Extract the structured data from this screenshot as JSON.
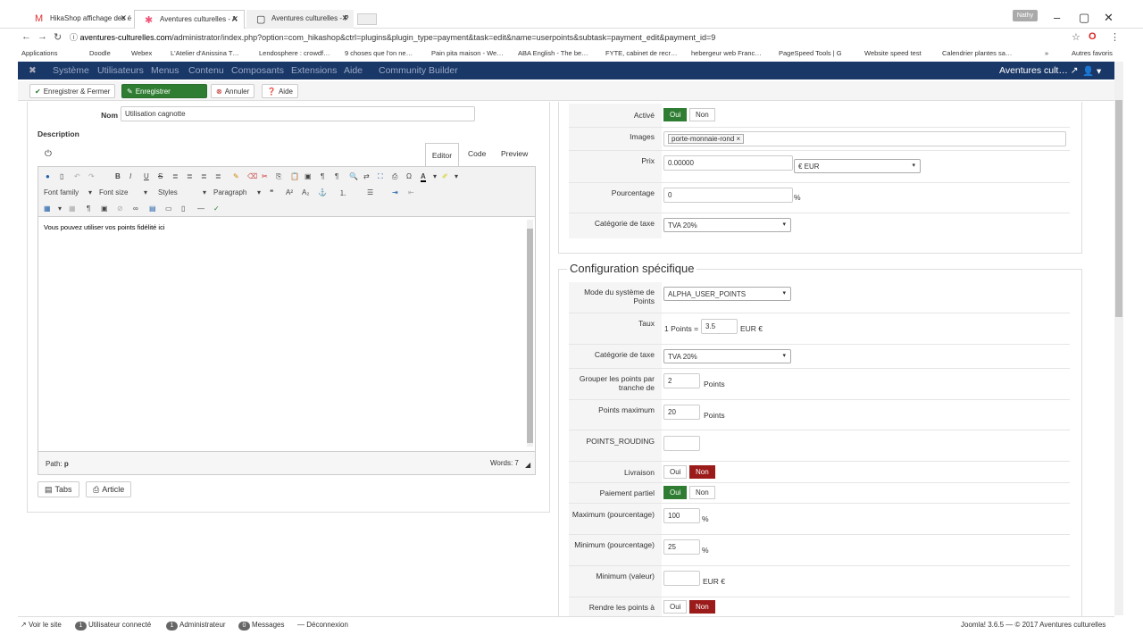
{
  "browser": {
    "tabs": [
      {
        "label": "HikaShop affichage des é",
        "icon": "gmail-icon"
      },
      {
        "label": "Aventures culturelles - A",
        "icon": "joomla-icon"
      },
      {
        "label": "Aventures culturelles - P",
        "icon": "page-icon"
      }
    ],
    "user_badge": "Nathy",
    "url_host": "aventures-culturelles.com",
    "url_path": "/administrator/index.php?option=com_hikashop&ctrl=plugins&plugin_type=payment&task=edit&name=userpoints&subtask=payment_edit&payment_id=9",
    "bookmarks": [
      "Applications",
      "Doodle",
      "Webex",
      "L'Atelier d'Anissina T…",
      "Lendosphere : crowdf…",
      "9 choses que l'on ne…",
      "Pain pita maison - We…",
      "ABA English - The be…",
      "FYTE, cabinet de recr…",
      "hebergeur web Franc…",
      "PageSpeed Tools | G",
      "Website speed test",
      "Calendrier plantes sa…",
      "»",
      "Autres favoris"
    ]
  },
  "joomla_nav": {
    "items": [
      "Système",
      "Utilisateurs",
      "Menus",
      "Contenu",
      "Composants",
      "Extensions",
      "Aide",
      "Community Builder"
    ],
    "site_name": "Aventures cult…"
  },
  "toolbar": {
    "save_close": "Enregistrer & Fermer",
    "save": "Enregistrer",
    "cancel": "Annuler",
    "help": "Aide"
  },
  "left": {
    "nom_label": "Nom",
    "nom_value": "Utilisation cagnotte",
    "description_label": "Description",
    "editor_tabs": [
      "Editor",
      "Code",
      "Preview"
    ],
    "font_family": "Font family",
    "font_size": "Font size",
    "styles": "Styles",
    "paragraph": "Paragraph",
    "content": "Vous pouvez utiliser vos points fidélité ici",
    "path_label": "Path:",
    "path_value": "p",
    "words": "Words: 7",
    "btn_tabs": "Tabs",
    "btn_article": "Article"
  },
  "right_general": {
    "active_label": "Activé",
    "oui": "Oui",
    "non": "Non",
    "images_label": "Images",
    "image_tag": "porte-monnaie-rond",
    "prix_label": "Prix",
    "prix_value": "0.00000",
    "currency": "€ EUR",
    "pourcentage_label": "Pourcentage",
    "pourcentage_value": "0",
    "percent": "%",
    "tax_label": "Catégorie de taxe",
    "tax_value": "TVA 20%"
  },
  "specific": {
    "legend": "Configuration spécifique",
    "mode_label": "Mode du système de Points",
    "mode_value": "ALPHA_USER_POINTS",
    "taux_label": "Taux",
    "taux_prefix": "1 Points =",
    "taux_value": "3.5",
    "taux_suffix": "EUR €",
    "tax_label": "Catégorie de taxe",
    "tax_value": "TVA 20%",
    "group_label": "Grouper les points par tranche de",
    "group_value": "2",
    "points_suffix": "Points",
    "max_label": "Points maximum",
    "max_value": "20",
    "rouding_label": "POINTS_ROUDING",
    "livraison_label": "Livraison",
    "partiel_label": "Paiement partiel",
    "maxpct_label": "Maximum (pourcentage)",
    "maxpct_value": "100",
    "minpct_label": "Minimum (pourcentage)",
    "minpct_value": "25",
    "minval_label": "Minimum (valeur)",
    "eur": "EUR €",
    "rendre_label": "Rendre les points à"
  },
  "footer": {
    "view_site": "Voir le site",
    "users_count": "1",
    "users_label": "Utilisateur connecté",
    "admin_count": "1",
    "admin_label": "Administrateur",
    "msg_count": "0",
    "msg_label": "Messages",
    "logout": "Déconnexion",
    "version": "Joomla! 3.6.5 — © 2017 Aventures culturelles"
  }
}
